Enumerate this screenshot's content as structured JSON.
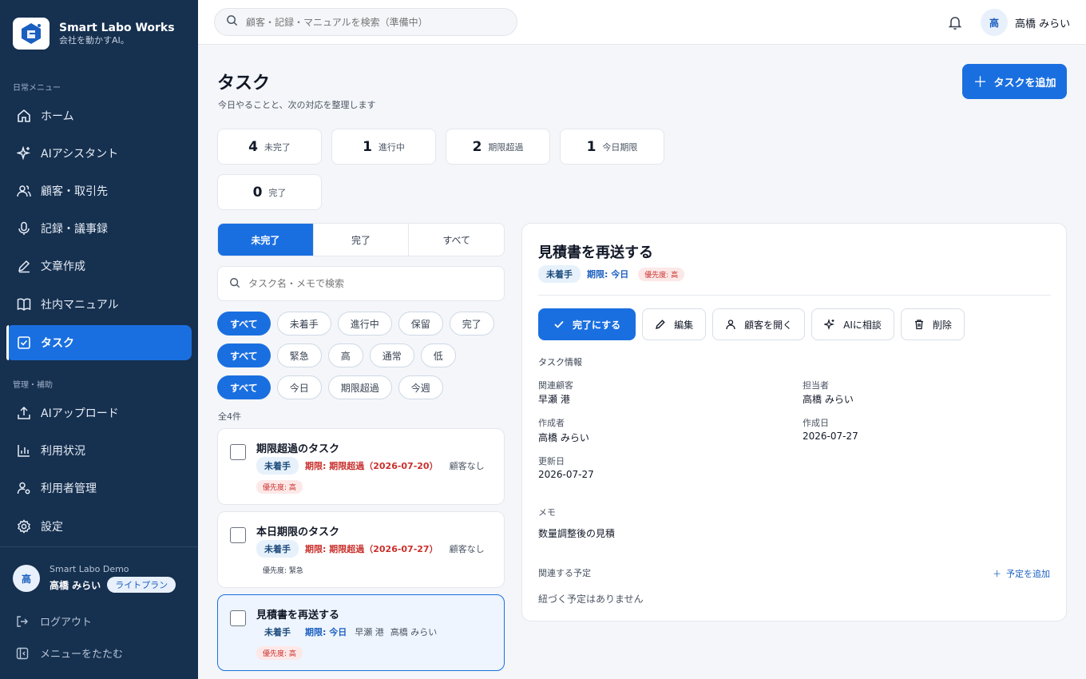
{
  "brand": {
    "name": "Smart Labo Works",
    "tagline": "会社を動かすAI。"
  },
  "sidebar": {
    "section_daily": "日常メニュー",
    "section_admin": "管理・補助",
    "items": [
      {
        "label": "ホーム",
        "icon": "home-icon"
      },
      {
        "label": "AIアシスタント",
        "icon": "sparkle-icon"
      },
      {
        "label": "顧客・取引先",
        "icon": "users-icon"
      },
      {
        "label": "記録・議事録",
        "icon": "mic-icon"
      },
      {
        "label": "文章作成",
        "icon": "pen-icon"
      },
      {
        "label": "社内マニュアル",
        "icon": "book-icon"
      },
      {
        "label": "タスク",
        "icon": "checkbox-icon"
      }
    ],
    "admin_items": [
      {
        "label": "AIアップロード",
        "icon": "upload-icon"
      },
      {
        "label": "利用状況",
        "icon": "bar-chart-icon"
      },
      {
        "label": "利用者管理",
        "icon": "user-gear-icon"
      },
      {
        "label": "設定",
        "icon": "gear-icon"
      }
    ],
    "user": {
      "org": "Smart Labo Demo",
      "name": "高橋 みらい",
      "avatar": "高",
      "plan": "ライトプラン"
    },
    "logout": "ログアウト",
    "collapse": "メニューをたたむ"
  },
  "topbar": {
    "search_placeholder": "顧客・記録・マニュアルを検索（準備中）",
    "user_avatar": "高",
    "user_name": "高橋 みらい"
  },
  "page": {
    "title": "タスク",
    "subtitle": "今日やることと、次の対応を整理します",
    "add_button": "タスクを追加"
  },
  "stats": [
    {
      "value": "4",
      "label": "未完了"
    },
    {
      "value": "1",
      "label": "進行中"
    },
    {
      "value": "2",
      "label": "期限超過"
    },
    {
      "value": "1",
      "label": "今日期限"
    },
    {
      "value": "0",
      "label": "完了"
    }
  ],
  "tabs": [
    "未完了",
    "完了",
    "すべて"
  ],
  "list_search_placeholder": "タスク名・メモで検索",
  "filters": {
    "status": [
      "すべて",
      "未着手",
      "進行中",
      "保留",
      "完了"
    ],
    "priority": [
      "すべて",
      "緊急",
      "高",
      "通常",
      "低"
    ],
    "due": [
      "すべて",
      "今日",
      "期限超過",
      "今週"
    ]
  },
  "count_label": "全4件",
  "tasks": [
    {
      "title": "期限超過のタスク",
      "status": "未着手",
      "due": "期限: 期限超過（2026-07-20）",
      "customer": "顧客なし",
      "assignee": "",
      "priority": "優先度: 高"
    },
    {
      "title": "本日期限のタスク",
      "status": "未着手",
      "due": "期限: 期限超過（2026-07-27）",
      "customer": "顧客なし",
      "assignee": "",
      "priority": "優先度: 緊急"
    },
    {
      "title": "見積書を再送する",
      "status": "未着手",
      "due": "期限: 今日",
      "customer": "早瀬 港",
      "assignee": "高橋 みらい",
      "priority": "優先度: 高"
    }
  ],
  "detail": {
    "title": "見積書を再送する",
    "status": "未着手",
    "due": "期限: 今日",
    "priority": "優先度: 高",
    "actions": {
      "complete": "完了にする",
      "edit": "編集",
      "open_customer": "顧客を開く",
      "ask_ai": "AIに相談",
      "delete": "削除"
    },
    "info_title": "タスク情報",
    "fields": {
      "customer_label": "関連顧客",
      "customer": "早瀬 港",
      "assignee_label": "担当者",
      "assignee": "高橋 みらい",
      "creator_label": "作成者",
      "creator": "高橋 みらい",
      "created_label": "作成日",
      "created": "2026-07-27",
      "updated_label": "更新日",
      "updated": "2026-07-27"
    },
    "memo_label": "メモ",
    "memo": "数量調整後の見積",
    "schedule_label": "関連する予定",
    "add_schedule": "予定を追加",
    "no_schedule": "紐づく予定はありません"
  },
  "colors": {
    "sidebar": "#16304f",
    "accent": "#1a6fe0",
    "danger": "#c9302c"
  }
}
